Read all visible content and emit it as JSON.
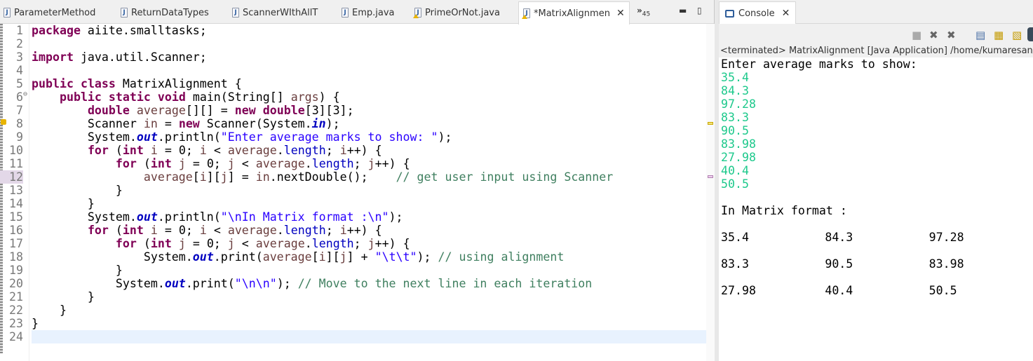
{
  "editor": {
    "tabs": [
      {
        "label": "ParameterMethod",
        "warn": false
      },
      {
        "label": "ReturnDataTypes",
        "warn": false
      },
      {
        "label": "ScannerWIthAllT",
        "warn": false
      },
      {
        "label": "Emp.java",
        "warn": false
      },
      {
        "label": "PrimeOrNot.java",
        "warn": true
      },
      {
        "label": "*MatrixAlignmen",
        "warn": true,
        "active": true
      }
    ],
    "overflow_label": "»",
    "overflow_count": "45",
    "lines": [
      [
        [
          "k",
          "package"
        ],
        [
          "t",
          " aiite.smalltasks;"
        ]
      ],
      [],
      [
        [
          "k",
          "import"
        ],
        [
          "t",
          " java.util.Scanner;"
        ]
      ],
      [],
      [
        [
          "k",
          "public"
        ],
        [
          "t",
          " "
        ],
        [
          "k",
          "class"
        ],
        [
          "t",
          " MatrixAlignment {"
        ]
      ],
      [
        [
          "t",
          "    "
        ],
        [
          "k",
          "public"
        ],
        [
          "t",
          " "
        ],
        [
          "k",
          "static"
        ],
        [
          "t",
          " "
        ],
        [
          "k",
          "void"
        ],
        [
          "t",
          " main(String[] "
        ],
        [
          "v",
          "args"
        ],
        [
          "t",
          ") {"
        ]
      ],
      [
        [
          "t",
          "        "
        ],
        [
          "k",
          "double"
        ],
        [
          "t",
          " "
        ],
        [
          "v",
          "average"
        ],
        [
          "t",
          "[][] = "
        ],
        [
          "k",
          "new"
        ],
        [
          "t",
          " "
        ],
        [
          "k",
          "double"
        ],
        [
          "t",
          "[3][3];"
        ]
      ],
      [
        [
          "t",
          "        Scanner "
        ],
        [
          "v",
          "in"
        ],
        [
          "t",
          " = "
        ],
        [
          "k",
          "new"
        ],
        [
          "t",
          " Scanner(System."
        ],
        [
          "s",
          "in"
        ],
        [
          "t",
          ");"
        ]
      ],
      [
        [
          "t",
          "        System."
        ],
        [
          "s",
          "out"
        ],
        [
          "t",
          ".println("
        ],
        [
          "str",
          "\"Enter average marks to show: \""
        ],
        [
          "t",
          ");"
        ]
      ],
      [
        [
          "t",
          "        "
        ],
        [
          "k",
          "for"
        ],
        [
          "t",
          " ("
        ],
        [
          "k",
          "int"
        ],
        [
          "t",
          " "
        ],
        [
          "v",
          "i"
        ],
        [
          "t",
          " = 0; "
        ],
        [
          "v",
          "i"
        ],
        [
          "t",
          " < "
        ],
        [
          "v",
          "average"
        ],
        [
          "t",
          "."
        ],
        [
          "f",
          "length"
        ],
        [
          "t",
          "; "
        ],
        [
          "v",
          "i"
        ],
        [
          "t",
          "++) {"
        ]
      ],
      [
        [
          "t",
          "            "
        ],
        [
          "k",
          "for"
        ],
        [
          "t",
          " ("
        ],
        [
          "k",
          "int"
        ],
        [
          "t",
          " "
        ],
        [
          "v",
          "j"
        ],
        [
          "t",
          " = 0; "
        ],
        [
          "v",
          "j"
        ],
        [
          "t",
          " < "
        ],
        [
          "v",
          "average"
        ],
        [
          "t",
          "."
        ],
        [
          "f",
          "length"
        ],
        [
          "t",
          "; "
        ],
        [
          "v",
          "j"
        ],
        [
          "t",
          "++) {"
        ]
      ],
      [
        [
          "t",
          "                "
        ],
        [
          "v",
          "average"
        ],
        [
          "t",
          "["
        ],
        [
          "v",
          "i"
        ],
        [
          "t",
          "]["
        ],
        [
          "v",
          "j"
        ],
        [
          "t",
          "] = "
        ],
        [
          "v",
          "in"
        ],
        [
          "t",
          ".nextDouble();    "
        ],
        [
          "c",
          "// get user input using Scanner"
        ]
      ],
      [
        [
          "t",
          "            }"
        ]
      ],
      [
        [
          "t",
          "        }"
        ]
      ],
      [
        [
          "t",
          "        System."
        ],
        [
          "s",
          "out"
        ],
        [
          "t",
          ".println("
        ],
        [
          "str",
          "\"\\nIn Matrix format :\\n\""
        ],
        [
          "t",
          ");"
        ]
      ],
      [
        [
          "t",
          "        "
        ],
        [
          "k",
          "for"
        ],
        [
          "t",
          " ("
        ],
        [
          "k",
          "int"
        ],
        [
          "t",
          " "
        ],
        [
          "v",
          "i"
        ],
        [
          "t",
          " = 0; "
        ],
        [
          "v",
          "i"
        ],
        [
          "t",
          " < "
        ],
        [
          "v",
          "average"
        ],
        [
          "t",
          "."
        ],
        [
          "f",
          "length"
        ],
        [
          "t",
          "; "
        ],
        [
          "v",
          "i"
        ],
        [
          "t",
          "++) {"
        ]
      ],
      [
        [
          "t",
          "            "
        ],
        [
          "k",
          "for"
        ],
        [
          "t",
          " ("
        ],
        [
          "k",
          "int"
        ],
        [
          "t",
          " "
        ],
        [
          "v",
          "j"
        ],
        [
          "t",
          " = 0; "
        ],
        [
          "v",
          "j"
        ],
        [
          "t",
          " < "
        ],
        [
          "v",
          "average"
        ],
        [
          "t",
          "."
        ],
        [
          "f",
          "length"
        ],
        [
          "t",
          "; "
        ],
        [
          "v",
          "j"
        ],
        [
          "t",
          "++) {"
        ]
      ],
      [
        [
          "t",
          "                System."
        ],
        [
          "s",
          "out"
        ],
        [
          "t",
          ".print("
        ],
        [
          "v",
          "average"
        ],
        [
          "t",
          "["
        ],
        [
          "v",
          "i"
        ],
        [
          "t",
          "]["
        ],
        [
          "v",
          "j"
        ],
        [
          "t",
          "] + "
        ],
        [
          "str",
          "\"\\t\\t\""
        ],
        [
          "t",
          "); "
        ],
        [
          "c",
          "// using alignment"
        ]
      ],
      [
        [
          "t",
          "            }"
        ]
      ],
      [
        [
          "t",
          "            System."
        ],
        [
          "s",
          "out"
        ],
        [
          "t",
          ".print("
        ],
        [
          "str",
          "\"\\n\\n\""
        ],
        [
          "t",
          "); "
        ],
        [
          "c",
          "// Move to the next line in each iteration"
        ]
      ],
      [
        [
          "t",
          "        }"
        ]
      ],
      [
        [
          "t",
          "    }"
        ]
      ],
      [
        [
          "t",
          "}"
        ]
      ],
      []
    ],
    "fold_marker": "⊖"
  },
  "console": {
    "tab_label": "Console",
    "status": "<terminated> MatrixAlignment [Java Application] /home/kumaresan/.p",
    "prompt": "Enter average marks to show:",
    "inputs": [
      "35.4",
      "84.3",
      "97.28",
      "83.3",
      "90.5",
      "83.98",
      "27.98",
      "40.4",
      "50.5"
    ],
    "matrix_heading": "In Matrix format :",
    "matrix": [
      [
        "35.4",
        "84.3",
        "97.28"
      ],
      [
        "83.3",
        "90.5",
        "83.98"
      ],
      [
        "27.98",
        "40.4",
        "50.5"
      ]
    ]
  }
}
